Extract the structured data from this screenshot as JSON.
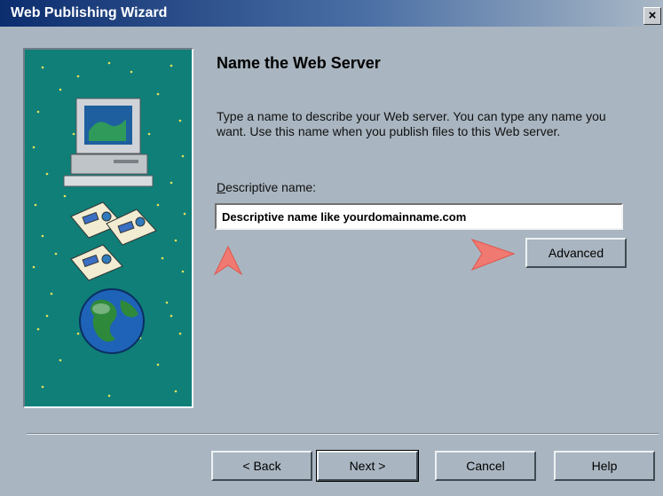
{
  "window": {
    "title": "Web Publishing Wizard",
    "close_glyph": "×"
  },
  "page": {
    "heading": "Name the Web Server",
    "description": "Type a name to describe your Web server. You can type any name you want. Use this name when you publish files to this Web server.",
    "field_label_access_key": "D",
    "field_label_rest": "escriptive name:",
    "field_value": "Descriptive name like yourdomainname.com"
  },
  "buttons": {
    "advanced": "Advanced",
    "back": "< Back",
    "next": "Next >",
    "cancel": "Cancel",
    "help": "Help"
  },
  "illustration": {
    "items": [
      "computer-icon",
      "document-icon",
      "document-icon",
      "document-icon",
      "globe-icon"
    ]
  },
  "annotations": {
    "arrow_color": "#f07a72"
  },
  "colors": {
    "dialog_bg": "#a9b5c0",
    "titlebar_start": "#0c2d6e",
    "art_bg": "#0f7f78"
  }
}
